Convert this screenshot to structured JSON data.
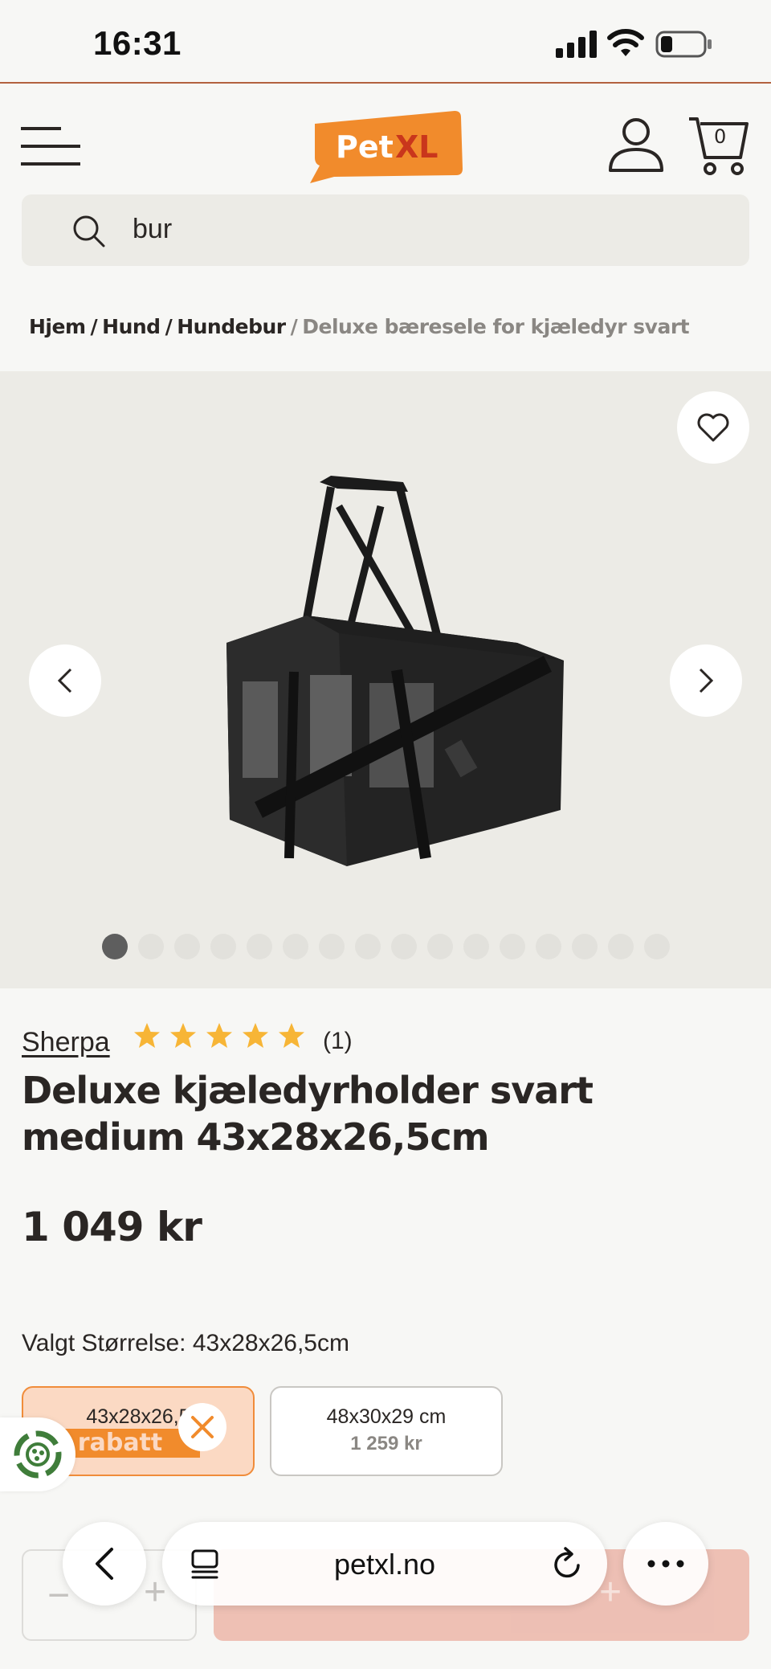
{
  "status_bar": {
    "time": "16:31",
    "icons": [
      "cellular-signal-icon",
      "wifi-icon",
      "battery-icon"
    ]
  },
  "header": {
    "logo_text_1": "Pet",
    "logo_text_2": "XL",
    "cart_count": "0",
    "brand_color": "#f18b2c",
    "icons": [
      "hamburger-menu-icon",
      "user-account-icon",
      "shopping-cart-icon"
    ]
  },
  "search": {
    "value": "bur",
    "placeholder": ""
  },
  "breadcrumb": {
    "items": [
      "Hjem",
      "Hund",
      "Hundebur"
    ],
    "current": "Deluxe bæresele for kjæledyr svart"
  },
  "gallery": {
    "image_count": 16,
    "active_index": 0,
    "image_alt": "Deluxe kjæledyrholder svart medium"
  },
  "product": {
    "brand": "Sherpa",
    "rating": 5,
    "max_rating": 5,
    "review_count": "(1)",
    "title": "Deluxe kjæledyrholder svart medium 43x28x26,5cm",
    "price": "1 049 kr",
    "star_color": "#f7b536"
  },
  "sizes": {
    "label": "Valgt Størrelse: 43x28x26,5cm",
    "options": [
      {
        "name": "43x28x26,5",
        "price": "",
        "selected": true
      },
      {
        "name": "48x30x29 cm",
        "price": "1 259 kr",
        "selected": false
      }
    ]
  },
  "promo": {
    "text": "n rabatt"
  },
  "cart_row": {
    "minus": "−",
    "plus": "+",
    "add_plus": "+"
  },
  "browser": {
    "url": "petxl.no"
  }
}
